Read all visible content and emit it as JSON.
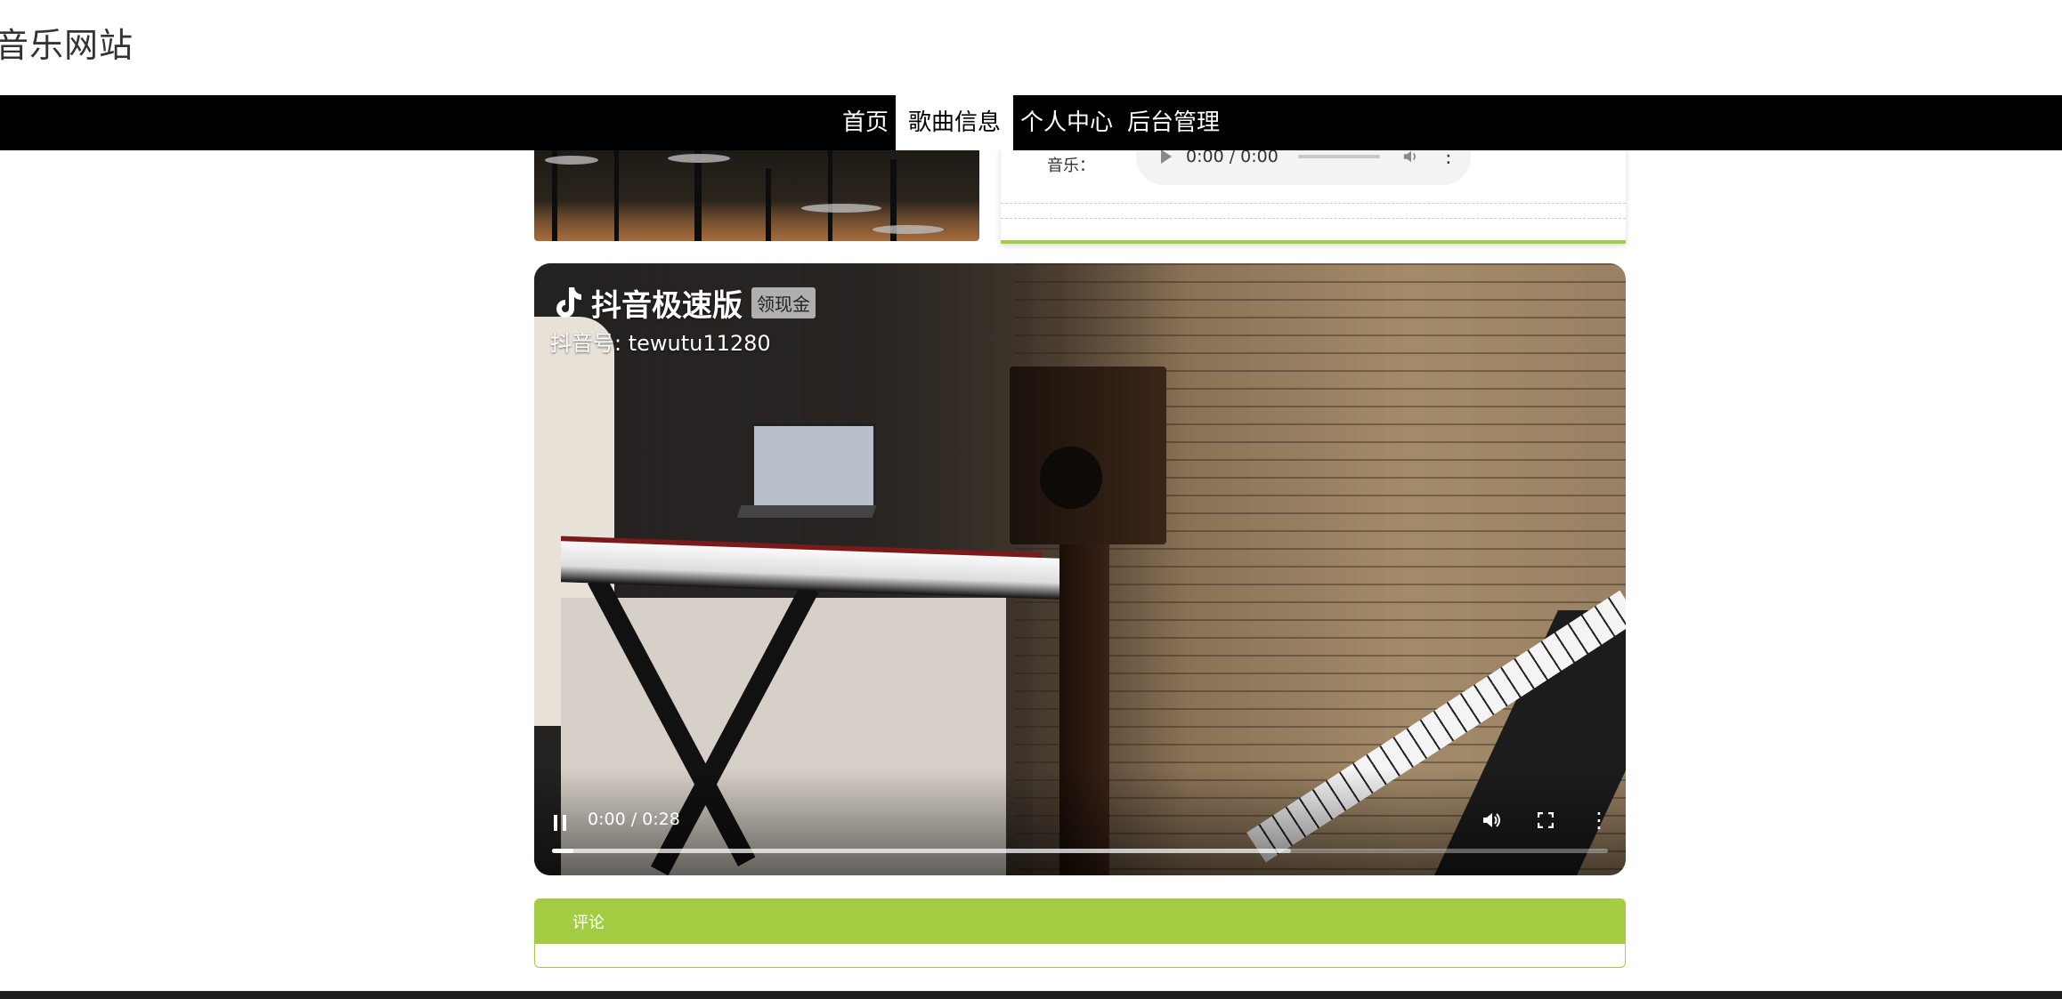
{
  "site": {
    "title": "音乐网站"
  },
  "nav": {
    "items": [
      {
        "label": "首页",
        "active": false
      },
      {
        "label": "歌曲信息",
        "active": true
      },
      {
        "label": "个人中心",
        "active": false
      },
      {
        "label": "后台管理",
        "active": false
      }
    ]
  },
  "song_info": {
    "music_label": "音乐：",
    "audio_player": {
      "time": "0:00 / 0:00",
      "state": "paused"
    }
  },
  "video": {
    "watermark_app": "抖音极速版",
    "watermark_badge": "领现金",
    "watermark_account": "抖音号: tewutu11280",
    "time": "0:00 / 0:28",
    "state": "playing",
    "buffered_fraction": 0.7,
    "played_fraction": 0.02
  },
  "comments": {
    "header": "评论"
  },
  "colors": {
    "accent": "#a4cc42",
    "nav_bg": "#000000"
  }
}
